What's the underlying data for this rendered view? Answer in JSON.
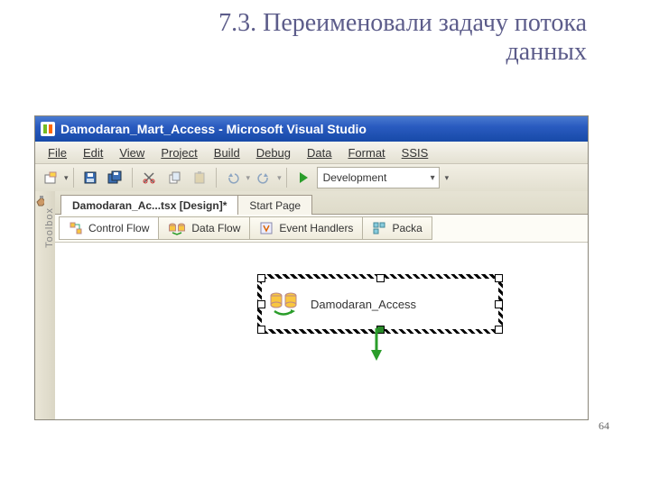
{
  "slide": {
    "title_line1": "7.3. Переименовали задачу потока",
    "title_line2": "данных",
    "page": "64"
  },
  "titlebar": {
    "app_icon_label": "VS",
    "text": "Damodaran_Mart_Access - Microsoft Visual Studio"
  },
  "menu": {
    "file": "File",
    "edit": "Edit",
    "view": "View",
    "project": "Project",
    "build": "Build",
    "debug": "Debug",
    "data": "Data",
    "format": "Format",
    "ssis": "SSIS"
  },
  "toolbar": {
    "config_label": "Development"
  },
  "doc_tabs": {
    "active": "Damodaran_Ac...tsx [Design]*",
    "inactive": "Start Page"
  },
  "designer_tabs": {
    "control_flow": "Control Flow",
    "data_flow": "Data Flow",
    "event_handlers": "Event Handlers",
    "package": "Packa"
  },
  "toolbox": {
    "label": "Toolbox"
  },
  "canvas": {
    "task_name": "Damodaran_Access"
  }
}
